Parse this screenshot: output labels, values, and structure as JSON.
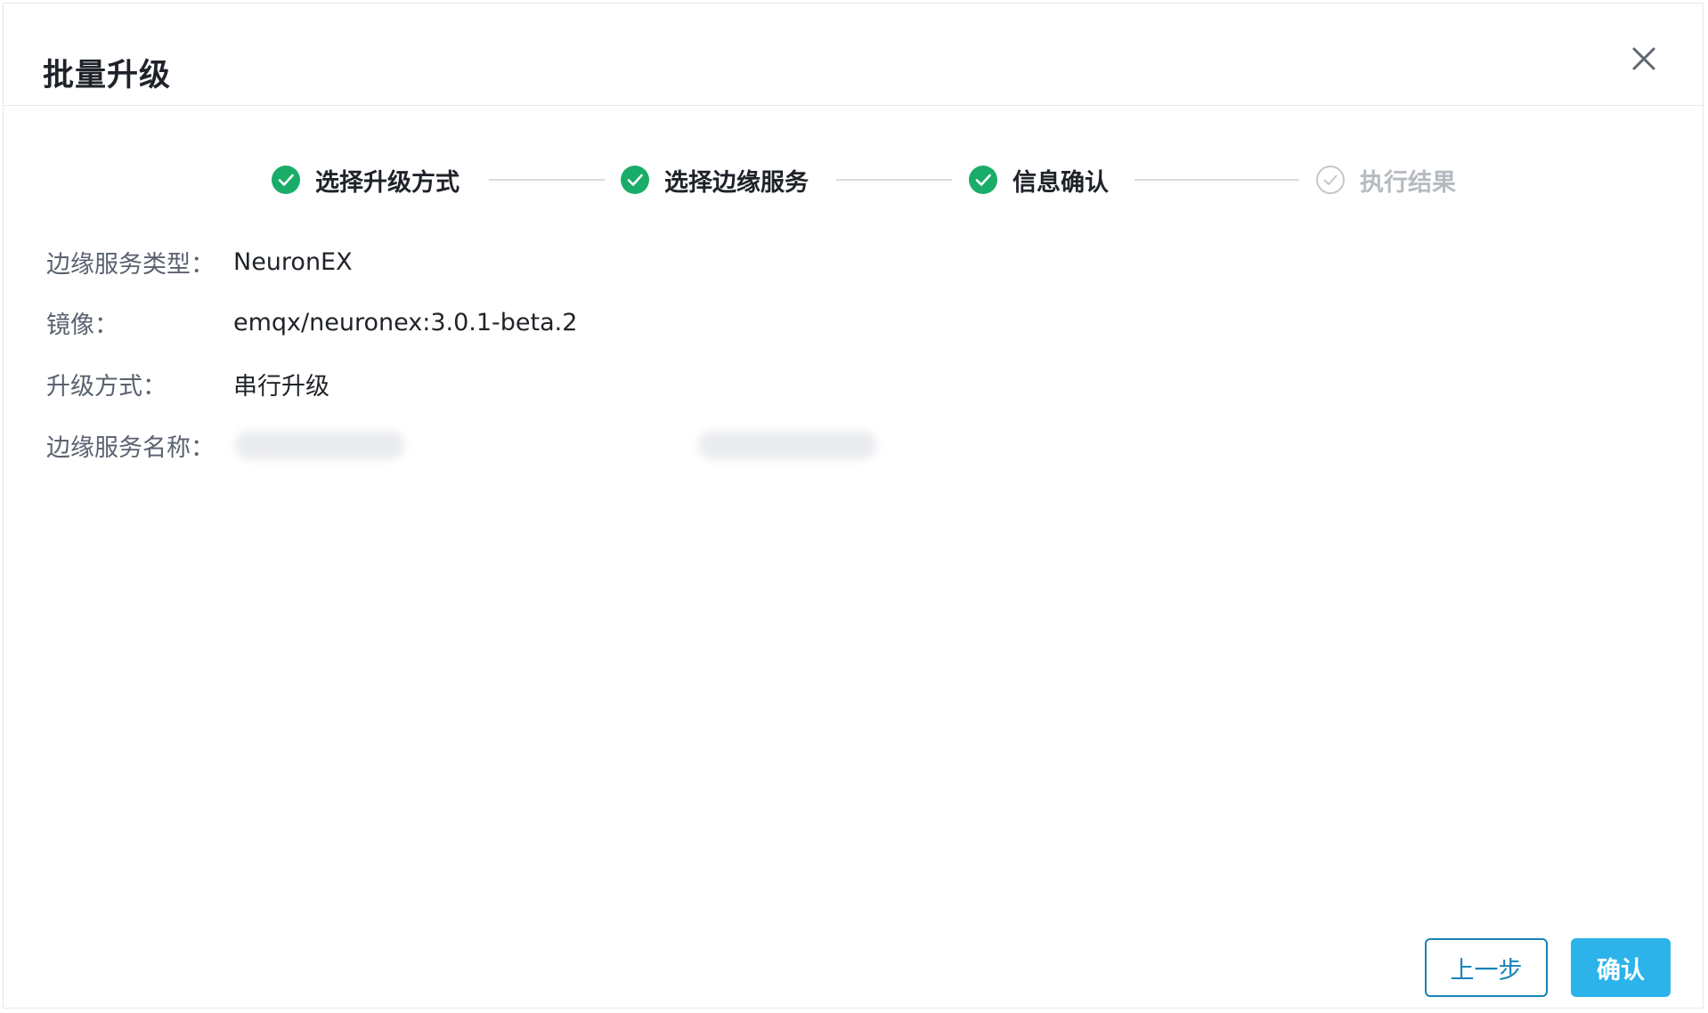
{
  "dialog": {
    "title": "批量升级",
    "close_icon": "close-icon"
  },
  "steps": [
    {
      "label": "选择升级方式",
      "status": "done",
      "icon": "check-circle-icon"
    },
    {
      "label": "选择边缘服务",
      "status": "done",
      "icon": "check-circle-icon"
    },
    {
      "label": "信息确认",
      "status": "done",
      "icon": "check-circle-icon"
    },
    {
      "label": "执行结果",
      "status": "pending",
      "icon": "check-circle-outline-icon"
    }
  ],
  "info": {
    "service_type_label": "边缘服务类型：",
    "service_type_value": "NeuronEX",
    "image_label": "镜像：",
    "image_value": "emqx/neuronex:3.0.1-beta.2",
    "upgrade_mode_label": "升级方式：",
    "upgrade_mode_value": "串行升级",
    "service_name_label": "边缘服务名称："
  },
  "footer": {
    "prev_label": "上一步",
    "confirm_label": "确认"
  },
  "colors": {
    "accent": "#2bb3ea",
    "accent_border": "#1883b8",
    "success": "#1aad6a",
    "pending": "#c4c8ce"
  }
}
